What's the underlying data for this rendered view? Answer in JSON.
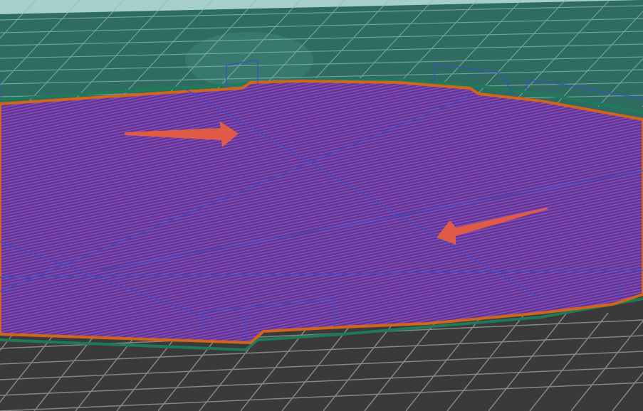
{
  "viewer": {
    "mode": "gcode-preview",
    "colors": {
      "sky": "#a7cfc9",
      "bed_upper": "#2e6b60",
      "bed_lower": "#393a39",
      "grid_line": "#8fb9b0",
      "grid_line_dark": "#a0a0a0",
      "infill": "#6a3a9c",
      "infill_line": "#8a55c4",
      "perimeter": "#d0651c",
      "skirt": "#1f7a5a",
      "travel": "#3b4fc8",
      "arrow": "#e05a48"
    },
    "annotations": [
      {
        "icon": "arrow-right-icon"
      },
      {
        "icon": "arrow-left-icon"
      }
    ]
  }
}
